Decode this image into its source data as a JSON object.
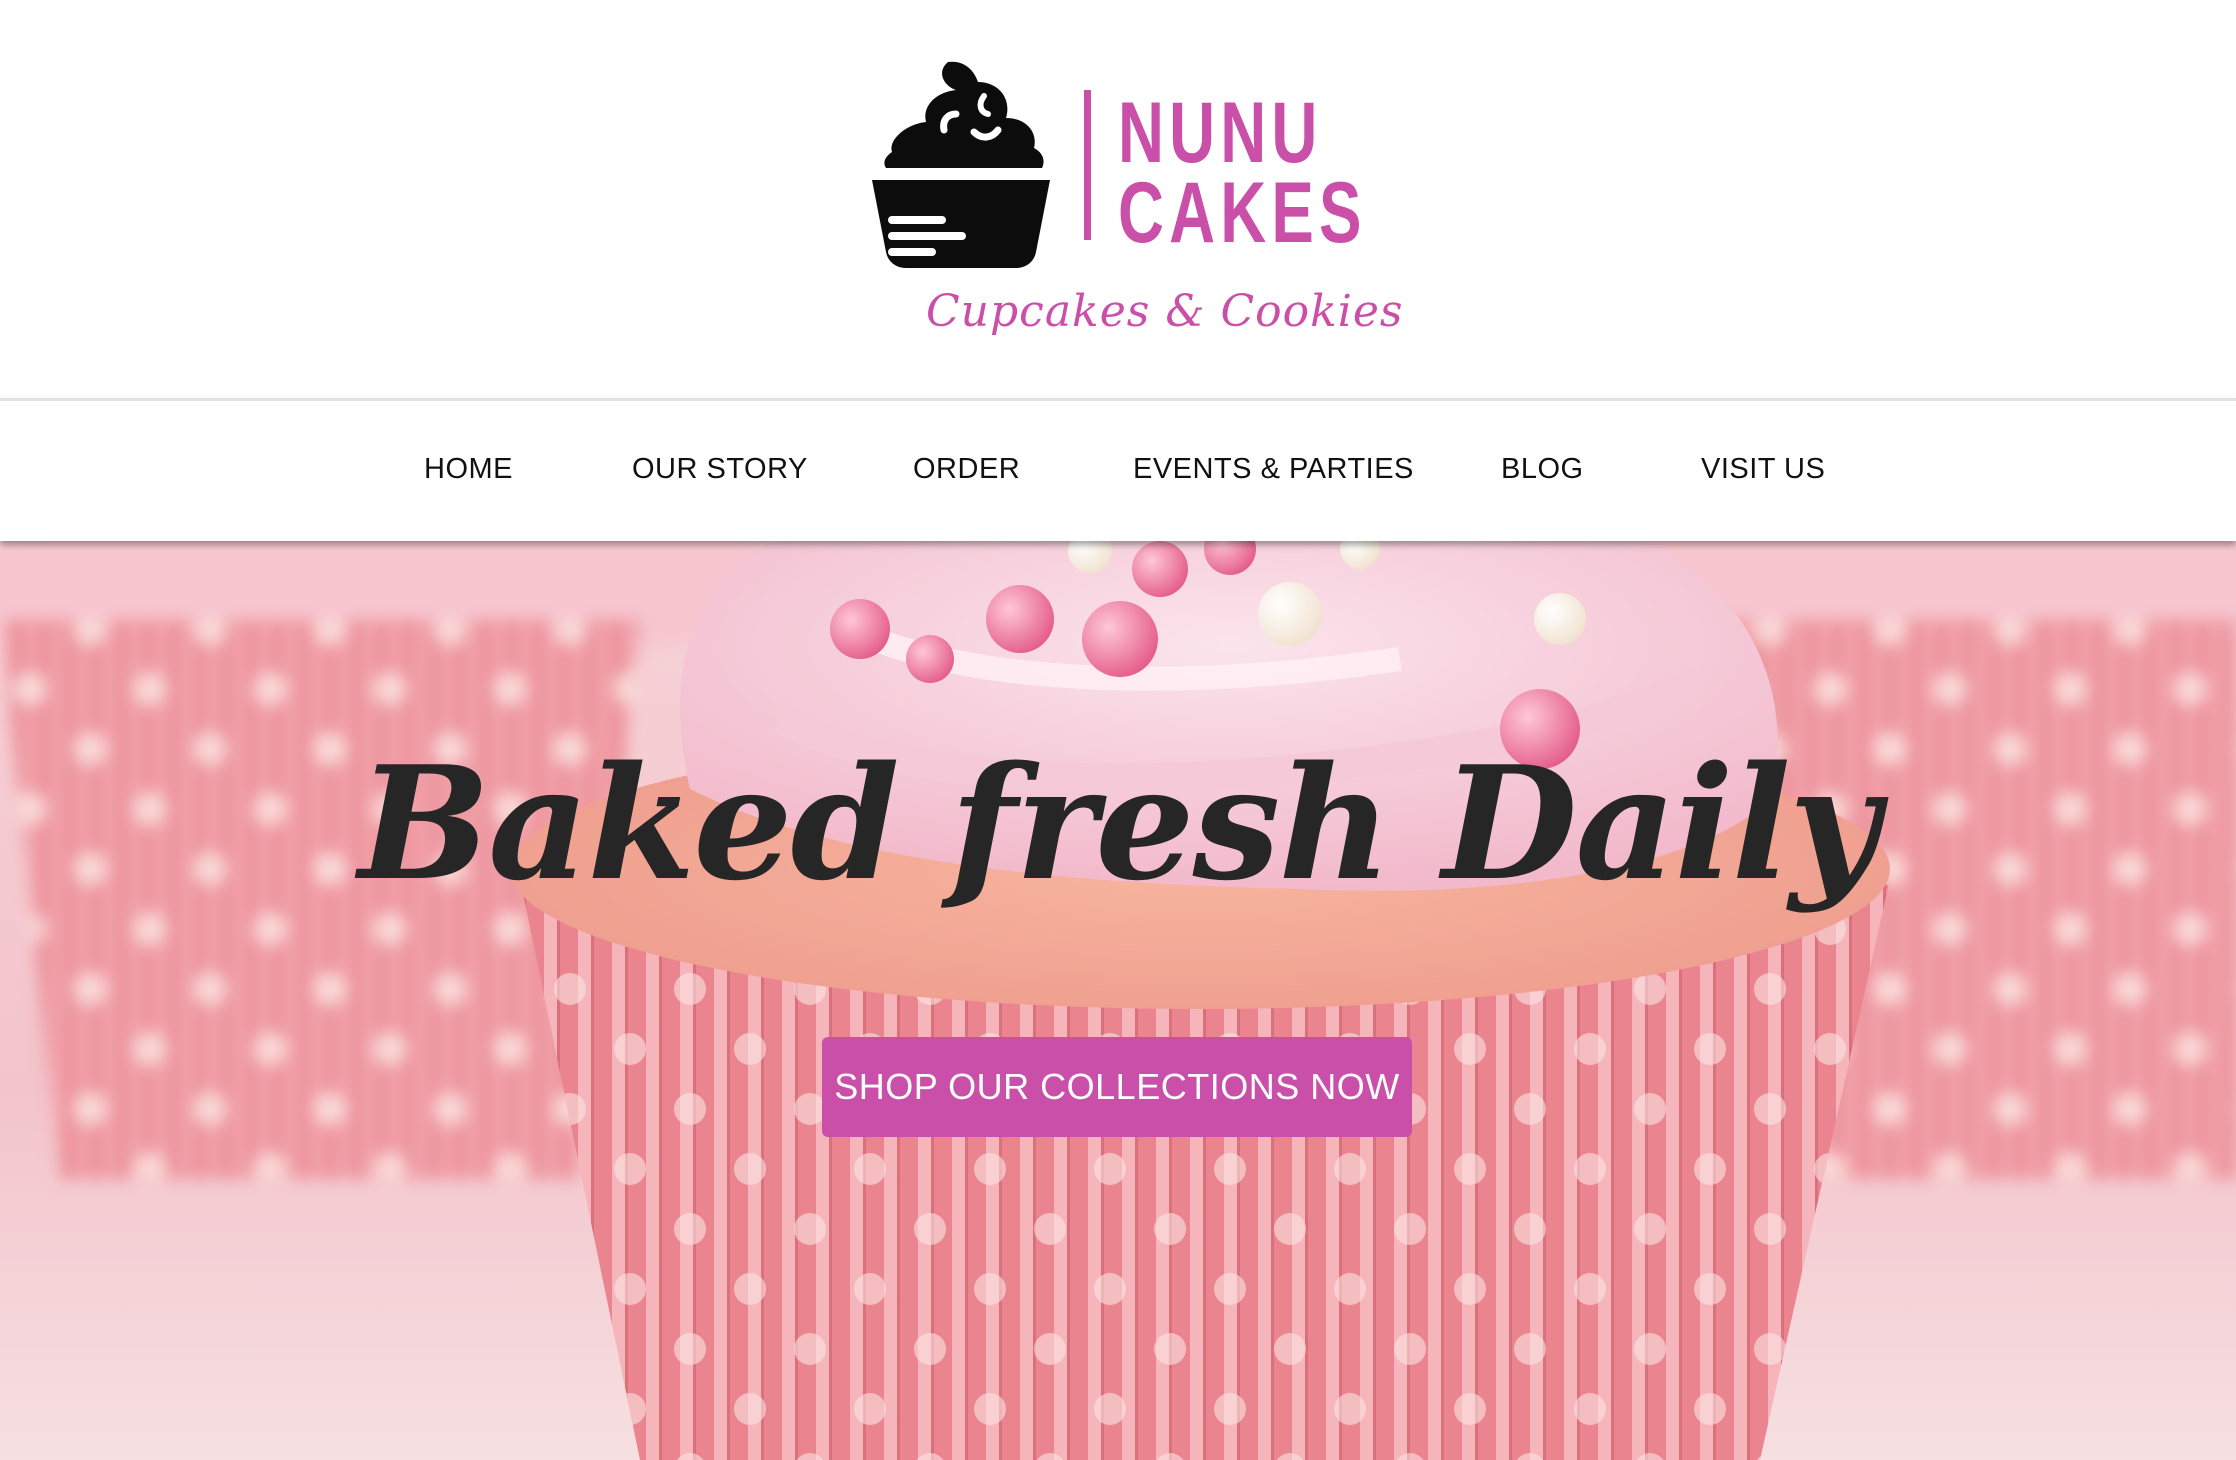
{
  "brand": {
    "name_line1": "NUNU",
    "name_line2": "CAKES",
    "tagline": "Cupcakes & Cookies",
    "logo_icon": "cupcake-icon"
  },
  "nav": {
    "items": [
      {
        "label": "HOME"
      },
      {
        "label": "OUR STORY"
      },
      {
        "label": "ORDER"
      },
      {
        "label": "EVENTS & PARTIES"
      },
      {
        "label": "BLOG"
      },
      {
        "label": "VISIT US"
      }
    ]
  },
  "hero": {
    "title": "Baked fresh Daily",
    "cta_label": "SHOP OUR COLLECTIONS NOW",
    "background": "pink-cupcake-photo"
  },
  "colors": {
    "brand_pink": "#c94fa9",
    "text_dark": "#262626",
    "nav_text": "#111111"
  }
}
